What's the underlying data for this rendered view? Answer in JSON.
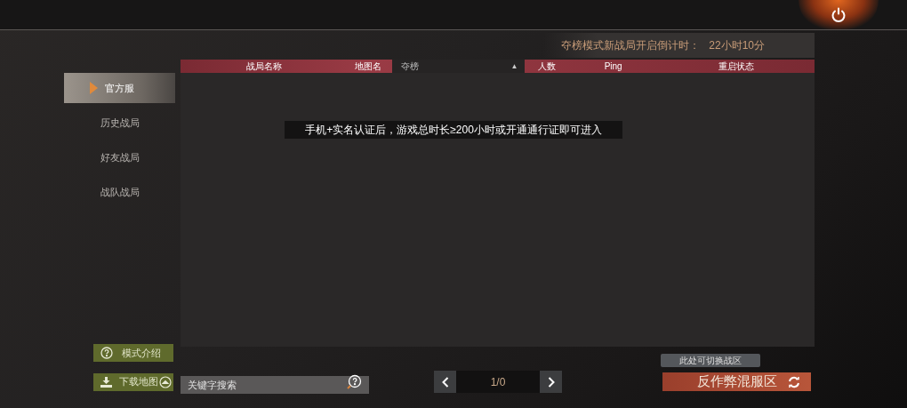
{
  "countdown": {
    "label": "夺榜模式新战局开启倒计时：",
    "value": "22小时10分"
  },
  "sidebar": {
    "items": [
      {
        "label": "官方服",
        "selected": true
      },
      {
        "label": "历史战局",
        "selected": false
      },
      {
        "label": "好友战局",
        "selected": false
      },
      {
        "label": "战队战局",
        "selected": false
      }
    ]
  },
  "table": {
    "columns": [
      {
        "kind": "label",
        "label": "战局名称"
      },
      {
        "kind": "label",
        "label": "地图名"
      },
      {
        "kind": "dropdown",
        "label": "夺榜",
        "arrow": "▲"
      },
      {
        "kind": "label",
        "label": "人数"
      },
      {
        "kind": "label",
        "label": "Ping"
      },
      {
        "kind": "label",
        "label": "重启状态"
      }
    ],
    "message": "手机+实名认证后，游戏总时长≥200小时或开通通行证即可进入"
  },
  "mode_intro_button": "模式介绍",
  "download_map_button": "下载地图",
  "search": {
    "placeholder": "关键字搜索"
  },
  "pager": {
    "page": "1/0"
  },
  "server": {
    "tooltip": "此处可切换战区",
    "button": "反作弊混服区"
  }
}
